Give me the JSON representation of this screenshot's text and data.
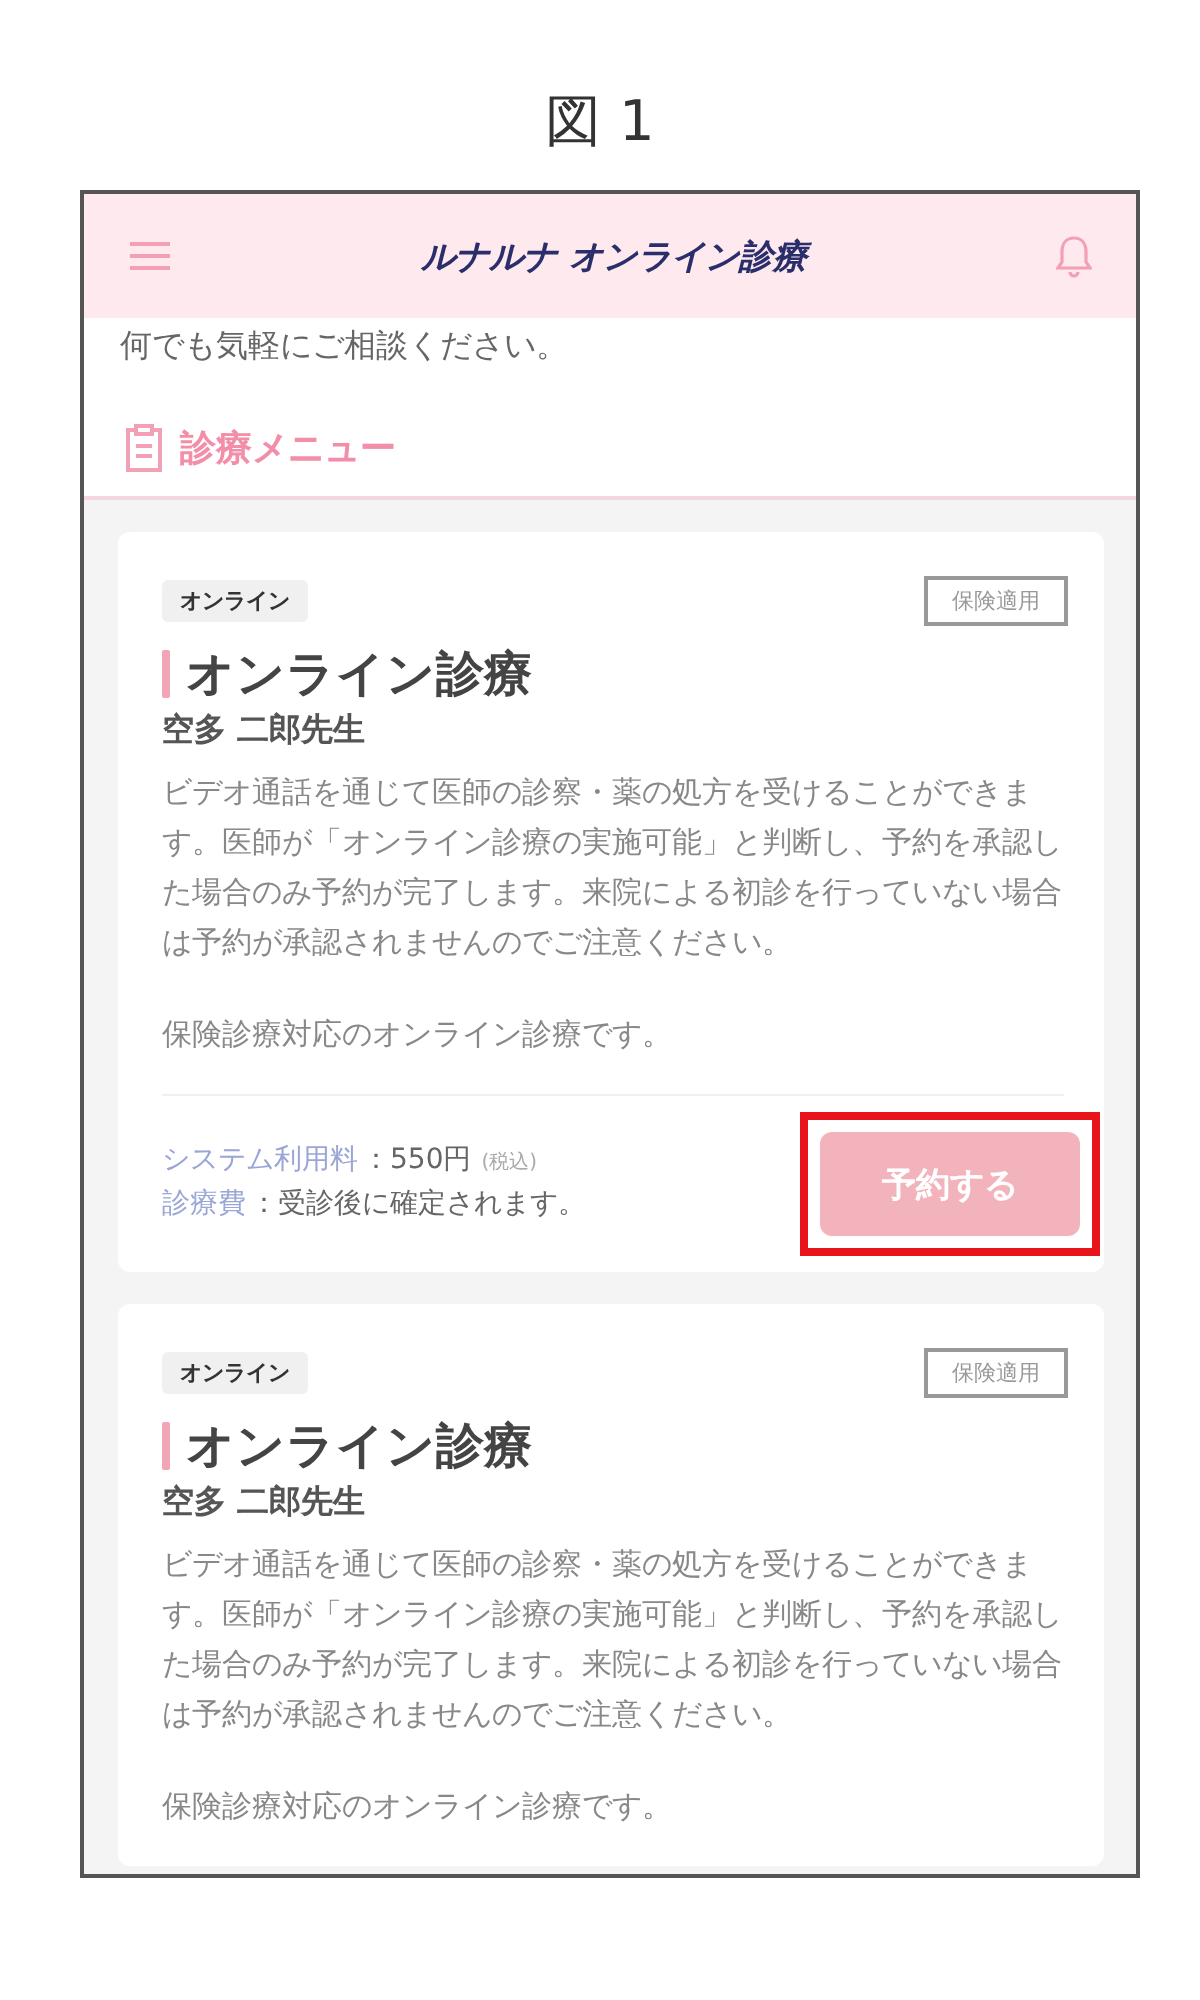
{
  "caption": "図 1",
  "header": {
    "title": "ルナルナ オンライン診療"
  },
  "intro": "何でも気軽にご相談ください。",
  "section_title": "診療メニュー",
  "cards": [
    {
      "tag": "オンライン",
      "badge": "保険適用",
      "title": "オンライン診療",
      "doctor": "空多 二郎先生",
      "description": "ビデオ通話を通じて医師の診察・薬の処方を受けることができます。医師が「オンライン診療の実施可能」と判断し、予約を承認した場合のみ予約が完了します。来院による初診を行っていない場合は予約が承認されませんのでご注意ください。",
      "note": "保険診療対応のオンライン診療です。",
      "fees": [
        {
          "label": "システム利用料",
          "value": "：550円",
          "suffix": "(税込)"
        },
        {
          "label": "診療費",
          "value": "：受診後に確定されます。"
        }
      ],
      "button": {
        "label": "予約する",
        "highlighted": true
      }
    },
    {
      "tag": "オンライン",
      "badge": "保険適用",
      "title": "オンライン診療",
      "doctor": "空多 二郎先生",
      "description": "ビデオ通話を通じて医師の診察・薬の処方を受けることができます。医師が「オンライン診療の実施可能」と判断し、予約を承認した場合のみ予約が完了します。来院による初診を行っていない場合は予約が承認されませんのでご注意ください。",
      "note": "保険診療対応のオンライン診療です。"
    }
  ]
}
